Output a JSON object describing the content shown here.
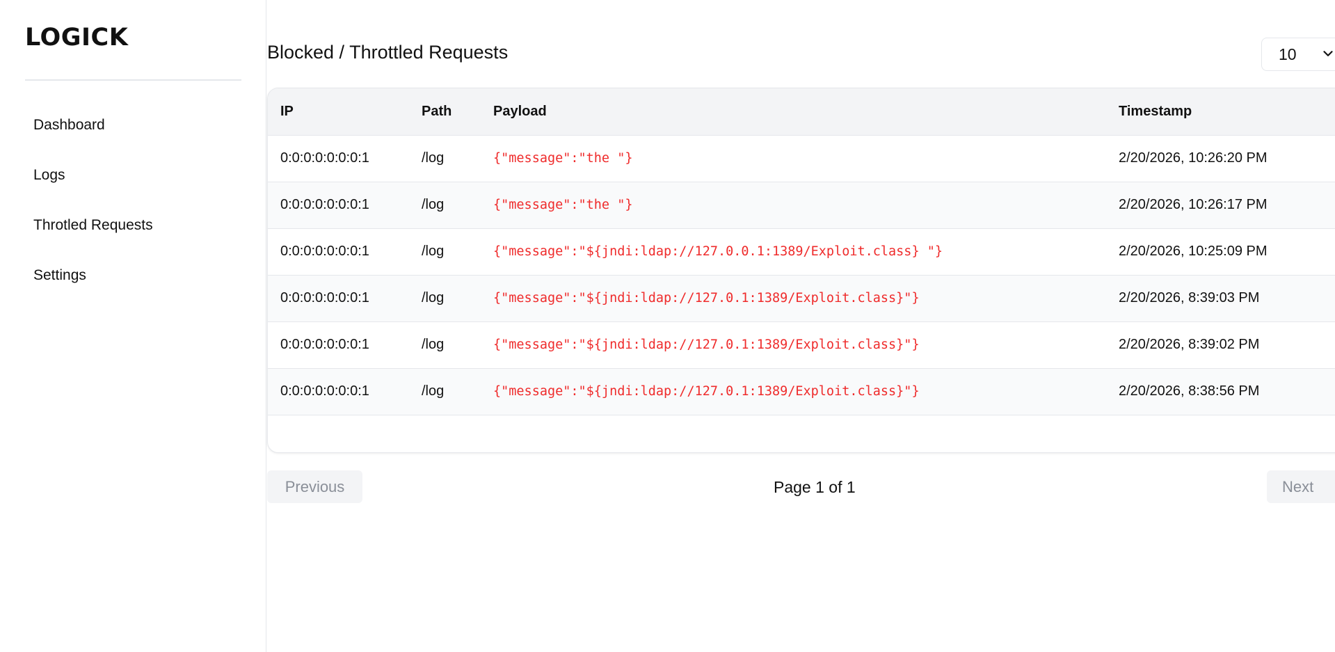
{
  "sidebar": {
    "brand": "LOGICK",
    "items": [
      {
        "label": "Dashboard"
      },
      {
        "label": "Logs"
      },
      {
        "label": "Throtled Requests"
      },
      {
        "label": "Settings"
      }
    ]
  },
  "main": {
    "title": "Blocked / Throttled Requests",
    "page_size": "10",
    "table": {
      "headers": {
        "ip": "IP",
        "path": "Path",
        "payload": "Payload",
        "timestamp": "Timestamp"
      },
      "rows": [
        {
          "ip": "0:0:0:0:0:0:0:1",
          "path": "/log",
          "payload": "{\"message\":\"the \"}",
          "timestamp": "2/20/2026, 10:26:20 PM"
        },
        {
          "ip": "0:0:0:0:0:0:0:1",
          "path": "/log",
          "payload": "{\"message\":\"the \"}",
          "timestamp": "2/20/2026, 10:26:17 PM"
        },
        {
          "ip": "0:0:0:0:0:0:0:1",
          "path": "/log",
          "payload": "{\"message\":\"${jndi:ldap://127.0.0.1:1389/Exploit.class} \"}",
          "timestamp": "2/20/2026, 10:25:09 PM"
        },
        {
          "ip": "0:0:0:0:0:0:0:1",
          "path": "/log",
          "payload": "{\"message\":\"${jndi:ldap://127.0.1:1389/Exploit.class}\"}",
          "timestamp": "2/20/2026, 8:39:03 PM"
        },
        {
          "ip": "0:0:0:0:0:0:0:1",
          "path": "/log",
          "payload": "{\"message\":\"${jndi:ldap://127.0.1:1389/Exploit.class}\"}",
          "timestamp": "2/20/2026, 8:39:02 PM"
        },
        {
          "ip": "0:0:0:0:0:0:0:1",
          "path": "/log",
          "payload": "{\"message\":\"${jndi:ldap://127.0.1:1389/Exploit.class}\"}",
          "timestamp": "2/20/2026, 8:38:56 PM"
        }
      ]
    },
    "pagination": {
      "previous_label": "Previous",
      "next_label": "Next",
      "page_info": "Page 1 of 1"
    }
  },
  "colors": {
    "payload_text": "#ef2b2b",
    "header_bg": "#f3f4f6",
    "border": "#e5e7eb",
    "disabled_button_bg": "#f3f4f6"
  },
  "icons": {
    "page_size_dropdown": "chevron-down-icon"
  }
}
